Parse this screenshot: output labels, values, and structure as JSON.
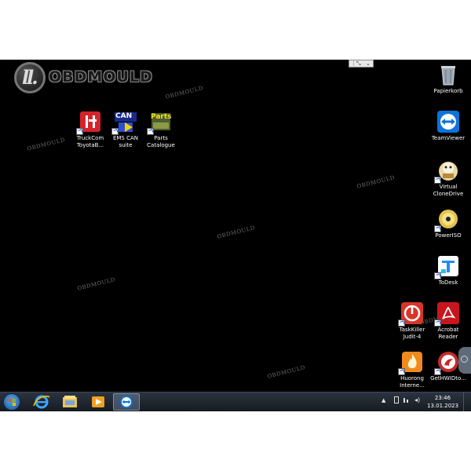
{
  "watermark": {
    "logo_mark": "ll.",
    "logo_text": "OBDMOULD",
    "repeat_text": "OBDMOULD"
  },
  "desktop_icons_left": [
    {
      "id": "truckcom",
      "label_line1": "TruckCom",
      "label_line2": "ToyotaB...",
      "icon": "truckcom-icon"
    },
    {
      "id": "ems-can",
      "label_line1": "EMS CAN",
      "label_line2": "suite",
      "icon": "ems-can-icon"
    },
    {
      "id": "parts-catalogue",
      "label_line1": "Parts",
      "label_line2": "Catalogue",
      "icon": "parts-catalogue-icon"
    }
  ],
  "desktop_icons_right": [
    {
      "id": "papierkorb",
      "label_line1": "Papierkorb",
      "label_line2": "",
      "icon": "recycle-bin-icon"
    },
    {
      "id": "teamviewer",
      "label_line1": "TeamViewer",
      "label_line2": "",
      "icon": "teamviewer-icon"
    },
    {
      "id": "virtual-clonedrive",
      "label_line1": "Virtual",
      "label_line2": "CloneDrive",
      "icon": "virtual-clonedrive-icon"
    },
    {
      "id": "poweriso",
      "label_line1": "PowerISO",
      "label_line2": "",
      "icon": "poweriso-icon"
    },
    {
      "id": "todesk",
      "label_line1": "ToDesk",
      "label_line2": "",
      "icon": "todesk-icon"
    },
    {
      "id": "taskkiller",
      "label_line1": "TaskKiller",
      "label_line2": "Judit-4",
      "icon": "taskkiller-icon"
    },
    {
      "id": "acrobat",
      "label_line1": "Acrobat",
      "label_line2": "Reader",
      "icon": "acrobat-reader-icon"
    },
    {
      "id": "huorong",
      "label_line1": "Huorong",
      "label_line2": "Interne...",
      "icon": "huorong-icon"
    },
    {
      "id": "gethwid",
      "label_line1": "GetHWIDto...",
      "label_line2": "",
      "icon": "gethwid-icon"
    }
  ],
  "ems_can_badge": "CAN",
  "parts_badge": "Parts",
  "taskbar": {
    "pinned": [
      "internet-explorer-icon",
      "file-explorer-icon",
      "media-player-icon",
      "teamviewer-taskbar-icon"
    ],
    "tray_arrow": "▲",
    "clock_time": "23:46",
    "clock_date": "13.01.2023"
  },
  "colors": {
    "desktop": "#000000",
    "taskbar": "#1d232b",
    "teamviewer_blue": "#0e74d8",
    "acrobat_red": "#c8161d",
    "taskkiller_red": "#d8352a"
  }
}
